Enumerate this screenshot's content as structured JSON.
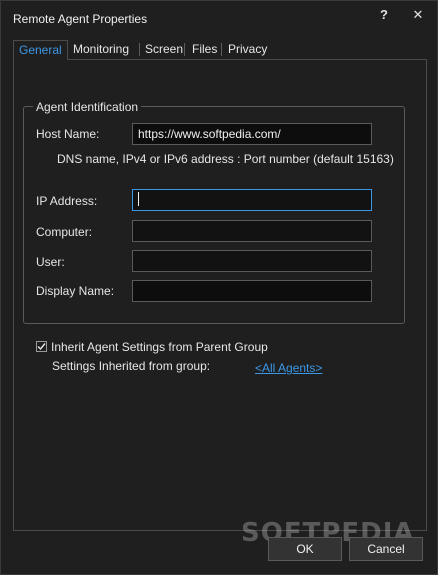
{
  "window": {
    "title": "Remote Agent Properties",
    "help_glyph": "?",
    "close_glyph": "✕"
  },
  "tabs": [
    {
      "label": "General",
      "active": true
    },
    {
      "label": "Monitoring",
      "active": false
    },
    {
      "label": "Screen",
      "active": false
    },
    {
      "label": "Files",
      "active": false
    },
    {
      "label": "Privacy",
      "active": false
    }
  ],
  "agent_identification": {
    "group_label": "Agent Identification",
    "host_name_label": "Host Name:",
    "host_name_value": "https://www.softpedia.com/",
    "hint": "DNS name, IPv4 or IPv6 address : Port number (default 15163)",
    "ip_address_label": "IP Address:",
    "ip_address_value": "",
    "computer_label": "Computer:",
    "computer_value": "",
    "user_label": "User:",
    "user_value": "",
    "display_name_label": "Display Name:",
    "display_name_value": ""
  },
  "inherit": {
    "checkbox_label": "Inherit Agent Settings from Parent Group",
    "checked": true,
    "inherited_label": "Settings Inherited from group:",
    "group_link": "<All Agents>"
  },
  "buttons": {
    "ok": "OK",
    "cancel": "Cancel"
  },
  "watermark": "SOFTPEDIA",
  "colors": {
    "accent": "#3c97e6",
    "background": "#1f1f1f",
    "border": "#5a5a5a"
  }
}
